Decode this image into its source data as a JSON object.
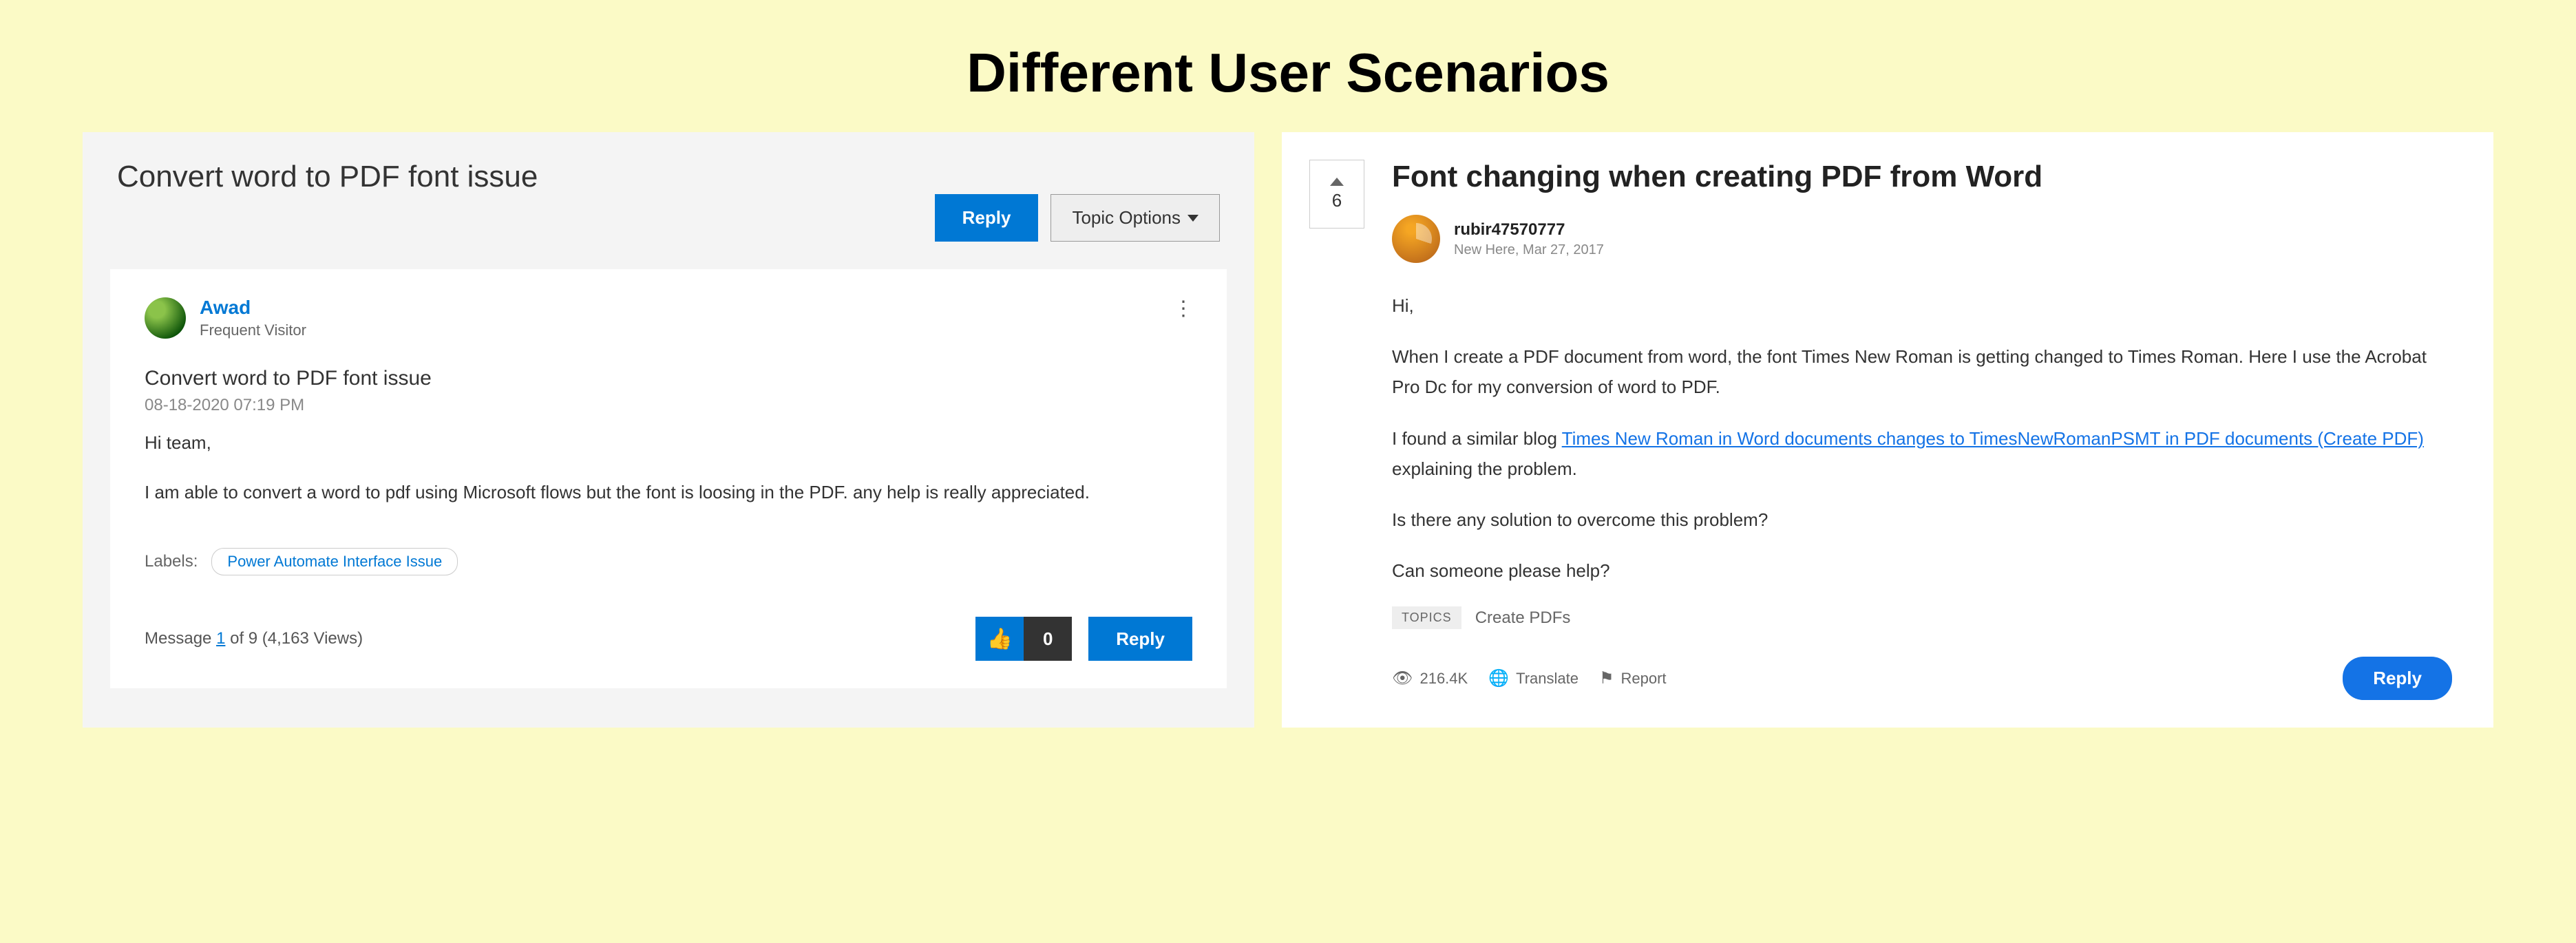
{
  "page": {
    "title": "Different User Scenarios"
  },
  "left": {
    "title": "Convert word to PDF font issue",
    "reply_btn": "Reply",
    "topic_options_btn": "Topic Options",
    "author": {
      "name": "Awad",
      "role": "Frequent Visitor"
    },
    "post_title": "Convert word to PDF font issue",
    "post_date": "08-18-2020 07:19 PM",
    "body": {
      "p1": "Hi team,",
      "p2": "I am able to convert a word to pdf using Microsoft flows but the font is loosing in the PDF. any help is really appreciated."
    },
    "labels_key": "Labels:",
    "labels_chip": "Power Automate Interface Issue",
    "message_prefix": "Message ",
    "message_link": "1",
    "message_suffix": " of 9  (4,163 Views)",
    "like_count": "0",
    "reply_sm": "Reply"
  },
  "right": {
    "vote_count": "6",
    "title": "Font changing when creating PDF from Word",
    "author": {
      "name": "rubir47570777",
      "meta": "New Here, Mar 27, 2017"
    },
    "body": {
      "p1": "Hi,",
      "p2": "When I create a PDF document from word, the font Times New Roman is getting changed to Times Roman. Here I use the Acrobat Pro Dc for my conversion of word to PDF.",
      "p3_prefix": "I found a similar blog ",
      "p3_link": "Times New Roman in Word documents changes to TimesNewRomanPSMT in PDF documents (Create PDF)",
      "p3_suffix": "  explaining the problem.",
      "p4": "Is there any solution to overcome this problem?",
      "p5": "Can someone please help?"
    },
    "topics_label": "TOPICS",
    "topics_value": "Create PDFs",
    "views": "216.4K",
    "translate": "Translate",
    "report": "Report",
    "reply_btn": "Reply"
  }
}
